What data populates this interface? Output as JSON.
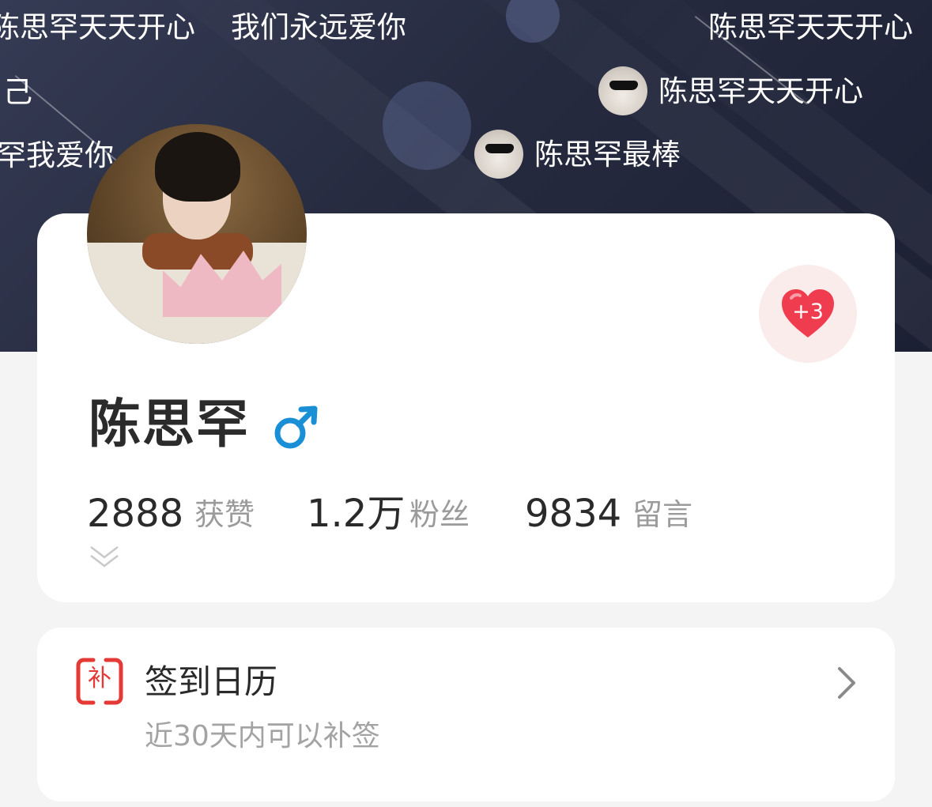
{
  "hero": {
    "danmu": [
      {
        "text": "陈思罕天天开心",
        "avatar": false
      },
      {
        "text": "我们永远爱你",
        "avatar": false
      },
      {
        "text": "陈思罕天天开心",
        "avatar": false
      },
      {
        "text": "己",
        "avatar": false
      },
      {
        "text": "陈思罕天天开心",
        "avatar": true,
        "avatar_icon": "cat-sunglasses-avatar"
      },
      {
        "text": "罕我爱你",
        "avatar": false
      },
      {
        "text": "陈思罕最棒",
        "avatar": true,
        "avatar_icon": "cat-sunglasses-avatar"
      }
    ]
  },
  "profile": {
    "avatar_icon": "user-photo-avatar",
    "name": "陈思罕",
    "gender_icon": "male-symbol-icon",
    "gender_color": "#1a8fd6",
    "like_button": {
      "icon": "heart-icon",
      "count": "+3",
      "color": "#f03c4f"
    },
    "stats": [
      {
        "value": "2888",
        "label": "获赞"
      },
      {
        "value": "1.2万",
        "label": "粉丝"
      },
      {
        "value": "9834",
        "label": "留言"
      }
    ],
    "expand_icon": "double-chevron-down-icon"
  },
  "checkin": {
    "icon_char": "补",
    "icon_color": "#e53935",
    "title": "签到日历",
    "subtitle": "近30天内可以补签",
    "chevron_icon": "chevron-right-icon"
  }
}
